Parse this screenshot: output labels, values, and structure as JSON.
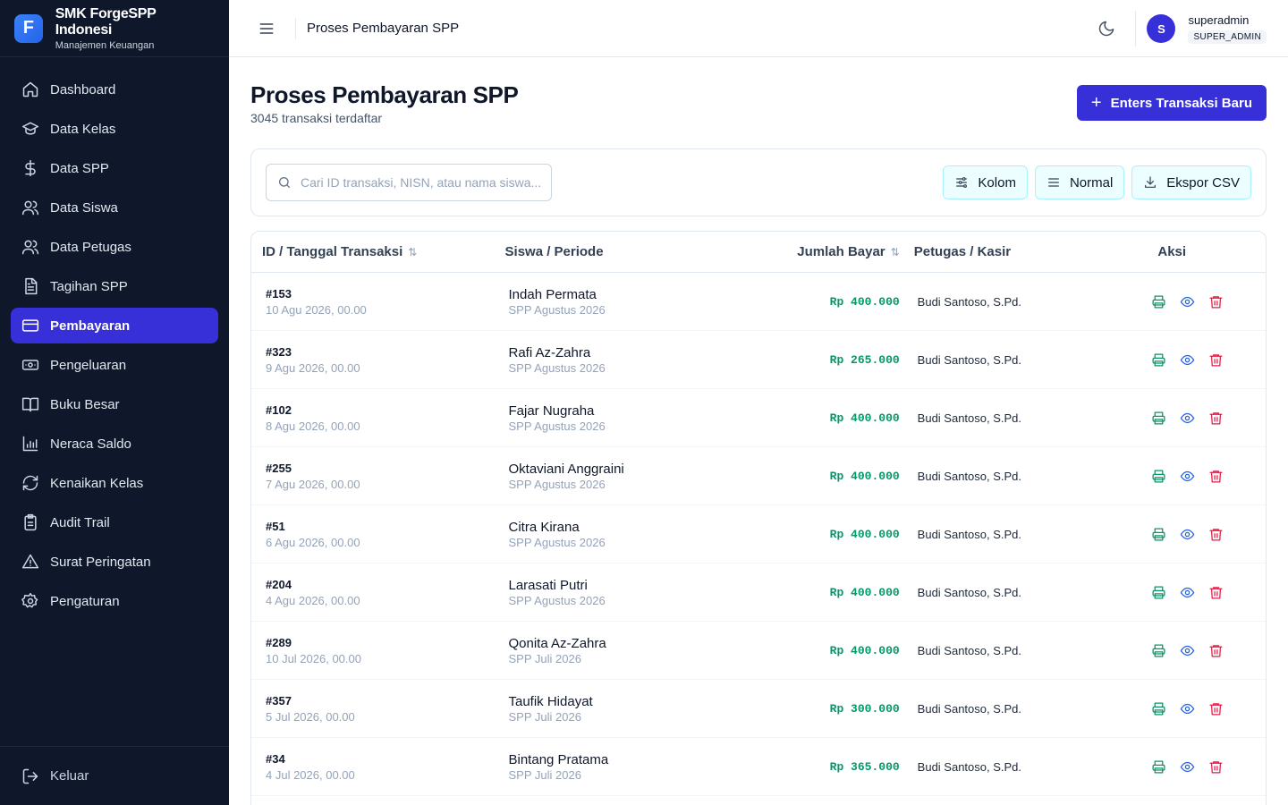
{
  "brand": {
    "logo_letter": "F",
    "name": "SMK ForgeSPP Indonesi",
    "subtitle": "Manajemen Keuangan"
  },
  "sidebar": {
    "items": [
      {
        "label": "Dashboard",
        "icon": "home-icon"
      },
      {
        "label": "Data Kelas",
        "icon": "graduation-cap-icon"
      },
      {
        "label": "Data SPP",
        "icon": "dollar-icon"
      },
      {
        "label": "Data Siswa",
        "icon": "users-icon"
      },
      {
        "label": "Data Petugas",
        "icon": "user-group-icon"
      },
      {
        "label": "Tagihan SPP",
        "icon": "document-icon"
      },
      {
        "label": "Pembayaran",
        "icon": "credit-card-icon",
        "active": true
      },
      {
        "label": "Pengeluaran",
        "icon": "banknote-icon"
      },
      {
        "label": "Buku Besar",
        "icon": "book-icon"
      },
      {
        "label": "Neraca Saldo",
        "icon": "bar-chart-icon"
      },
      {
        "label": "Kenaikan Kelas",
        "icon": "refresh-icon"
      },
      {
        "label": "Audit Trail",
        "icon": "clipboard-icon"
      },
      {
        "label": "Surat Peringatan",
        "icon": "warning-icon"
      },
      {
        "label": "Pengaturan",
        "icon": "gear-icon"
      }
    ],
    "logout_label": "Keluar"
  },
  "topbar": {
    "title": "Proses Pembayaran SPP",
    "user": {
      "initial": "S",
      "name": "superadmin",
      "role": "SUPER_ADMIN"
    }
  },
  "page": {
    "title": "Proses Pembayaran SPP",
    "subtitle": "3045 transaksi terdaftar",
    "new_button": "Enters Transaksi Baru"
  },
  "toolbar": {
    "search_placeholder": "Cari ID transaksi, NISN, atau nama siswa...",
    "search_value": "",
    "columns_label": "Kolom",
    "density_label": "Normal",
    "export_label": "Ekspor CSV"
  },
  "table": {
    "headers": [
      "ID / Tanggal Transaksi",
      "Siswa / Periode",
      "Jumlah Bayar",
      "Petugas / Kasir",
      "Aksi"
    ],
    "rows": [
      {
        "id": "#153",
        "date": "10 Agu 2026, 00.00",
        "name": "Indah Permata",
        "period": "SPP Agustus 2026",
        "amount": "Rp 400.000",
        "cashier": "Budi Santoso, S.Pd."
      },
      {
        "id": "#323",
        "date": "9 Agu 2026, 00.00",
        "name": "Rafi Az-Zahra",
        "period": "SPP Agustus 2026",
        "amount": "Rp 265.000",
        "cashier": "Budi Santoso, S.Pd."
      },
      {
        "id": "#102",
        "date": "8 Agu 2026, 00.00",
        "name": "Fajar Nugraha",
        "period": "SPP Agustus 2026",
        "amount": "Rp 400.000",
        "cashier": "Budi Santoso, S.Pd."
      },
      {
        "id": "#255",
        "date": "7 Agu 2026, 00.00",
        "name": "Oktaviani Anggraini",
        "period": "SPP Agustus 2026",
        "amount": "Rp 400.000",
        "cashier": "Budi Santoso, S.Pd."
      },
      {
        "id": "#51",
        "date": "6 Agu 2026, 00.00",
        "name": "Citra Kirana",
        "period": "SPP Agustus 2026",
        "amount": "Rp 400.000",
        "cashier": "Budi Santoso, S.Pd."
      },
      {
        "id": "#204",
        "date": "4 Agu 2026, 00.00",
        "name": "Larasati Putri",
        "period": "SPP Agustus 2026",
        "amount": "Rp 400.000",
        "cashier": "Budi Santoso, S.Pd."
      },
      {
        "id": "#289",
        "date": "10 Jul 2026, 00.00",
        "name": "Qonita Az-Zahra",
        "period": "SPP Juli 2026",
        "amount": "Rp 400.000",
        "cashier": "Budi Santoso, S.Pd."
      },
      {
        "id": "#357",
        "date": "5 Jul 2026, 00.00",
        "name": "Taufik Hidayat",
        "period": "SPP Juli 2026",
        "amount": "Rp 300.000",
        "cashier": "Budi Santoso, S.Pd."
      },
      {
        "id": "#34",
        "date": "4 Jul 2026, 00.00",
        "name": "Bintang Pratama",
        "period": "SPP Juli 2026",
        "amount": "Rp 365.000",
        "cashier": "Budi Santoso, S.Pd."
      }
    ]
  },
  "colors": {
    "sidebar_bg": "#0f172a",
    "accent": "#3730d8",
    "amount": "#059669",
    "delete": "#e11d48",
    "view": "#2563eb"
  }
}
